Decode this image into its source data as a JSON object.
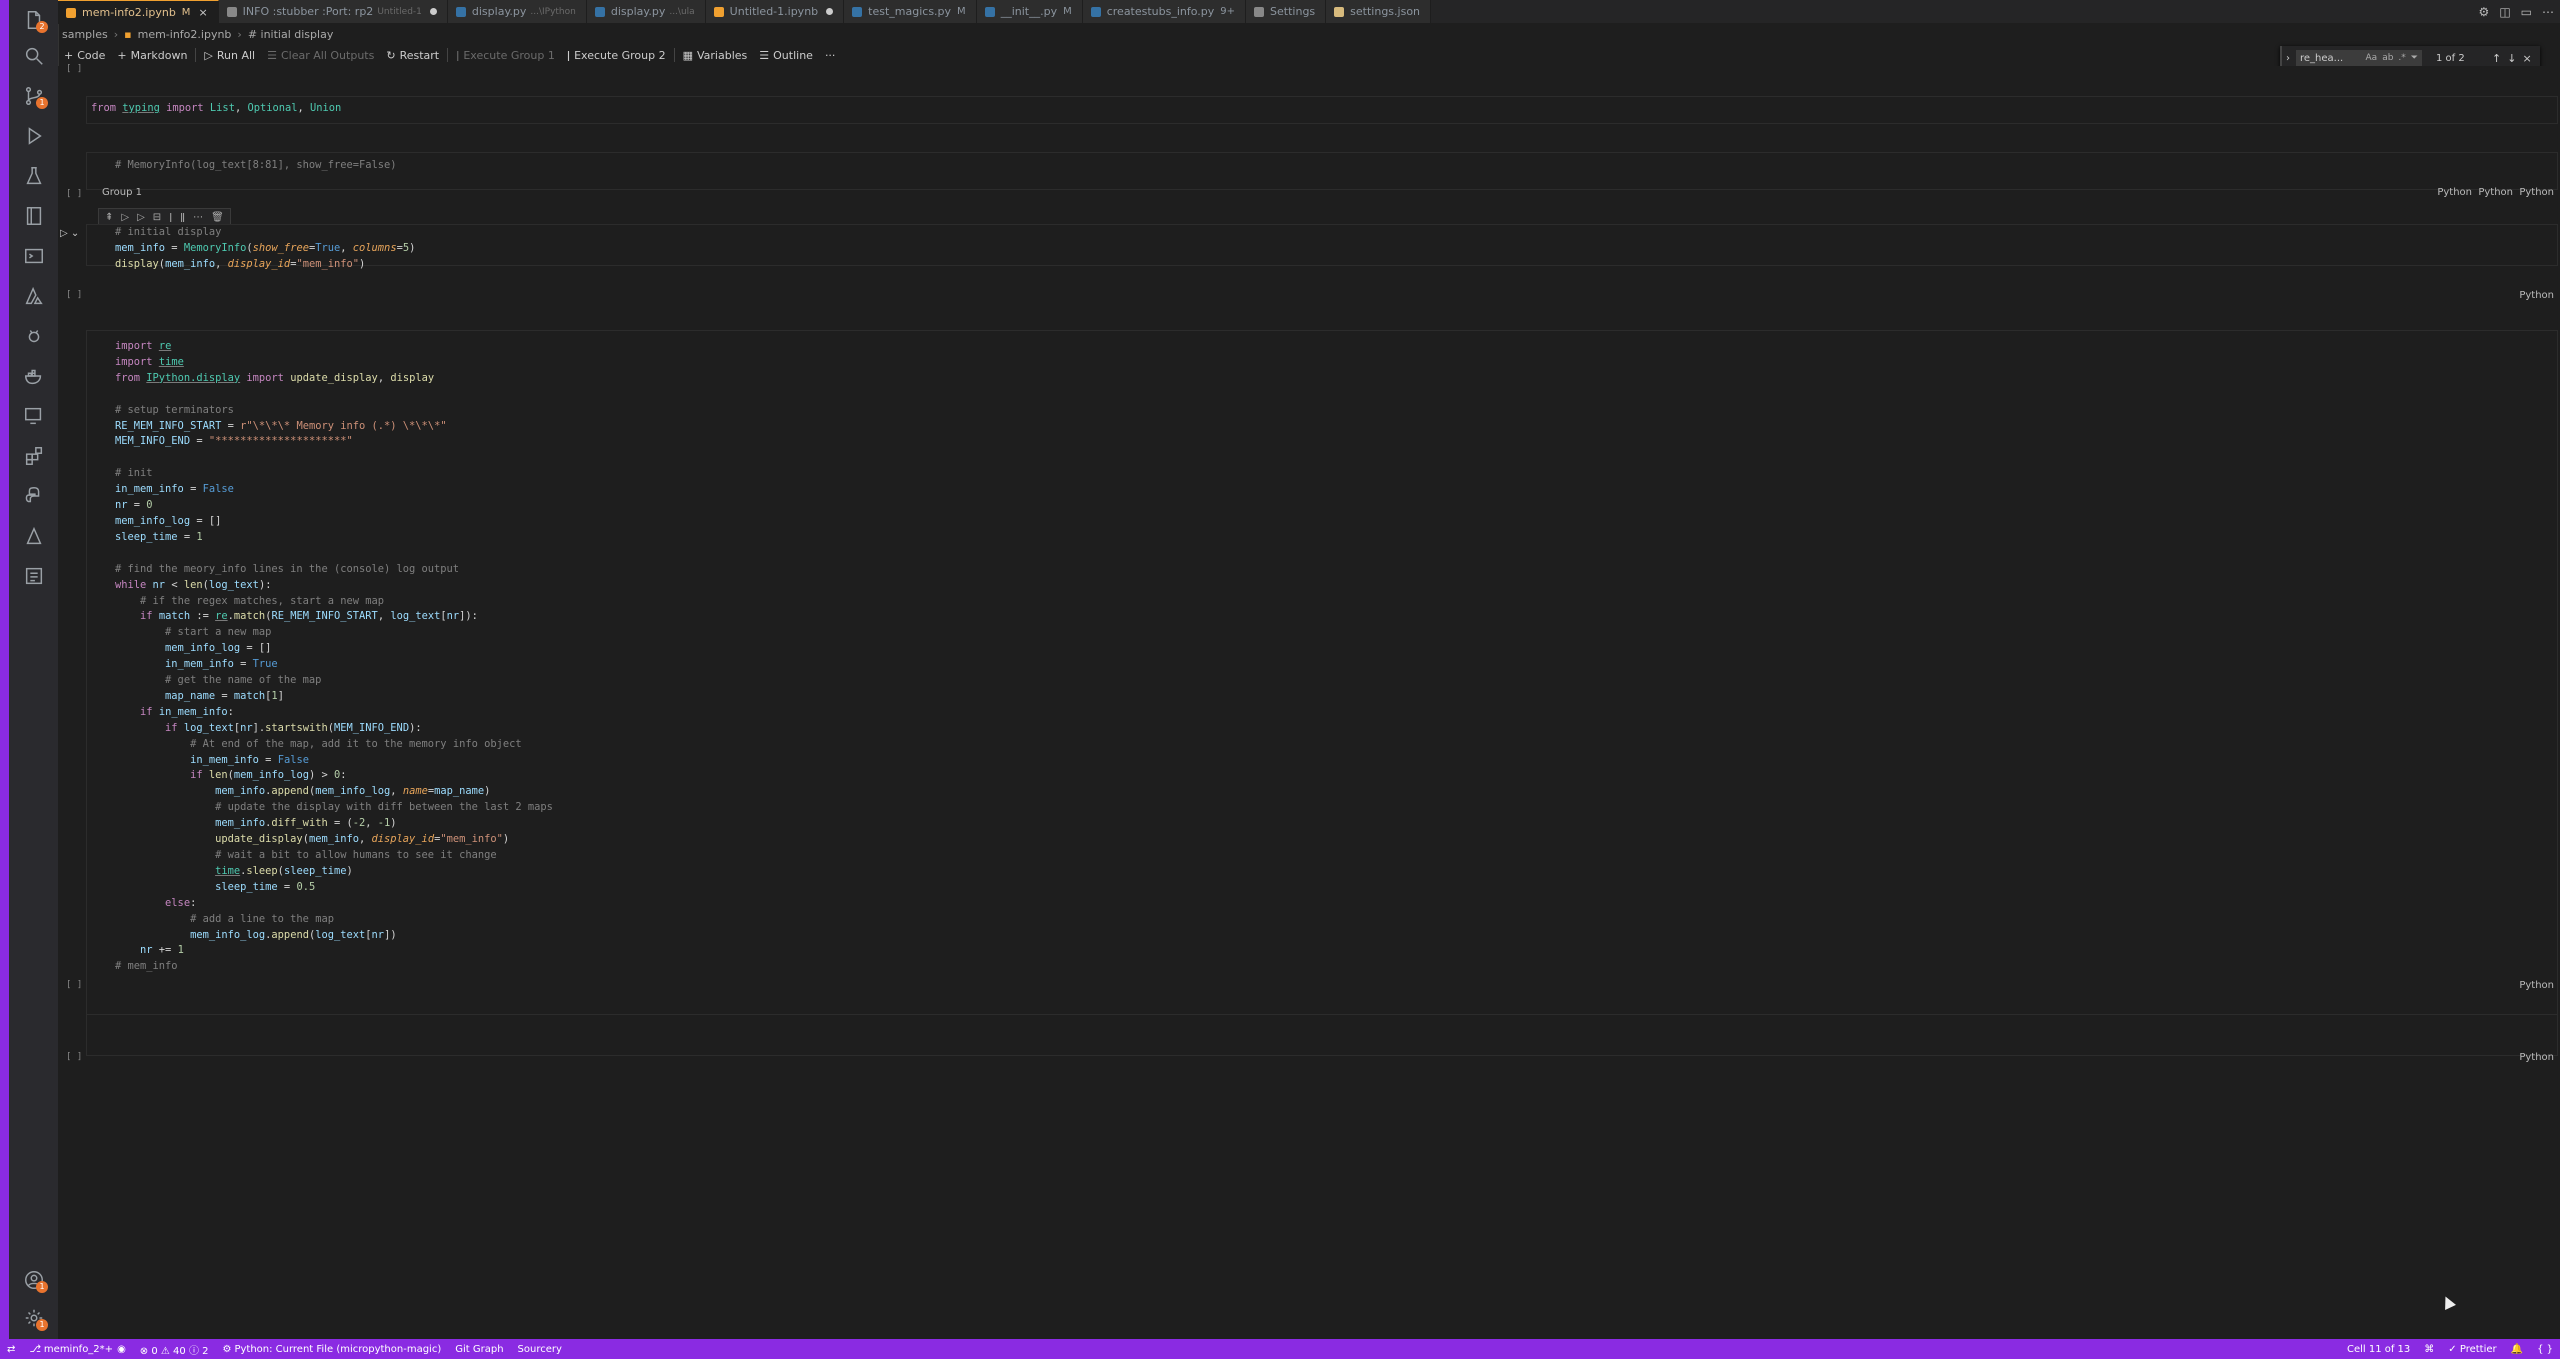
{
  "tabs": [
    {
      "label": "mem-info2.ipynb",
      "mark": "M",
      "active": true,
      "icon_color": "#f0a030",
      "close": "×"
    },
    {
      "label": "INFO :stubber :Port: rp2",
      "sub": "Untitled-1",
      "modified": true,
      "icon_color": "#888888"
    },
    {
      "label": "display.py",
      "sub": "...\\IPython",
      "icon_color": "#3572a5"
    },
    {
      "label": "display.py",
      "sub": "...\\ula",
      "icon_color": "#3572a5"
    },
    {
      "label": "Untitled-1.ipynb",
      "modified": true,
      "icon_color": "#f0a030"
    },
    {
      "label": "test_magics.py",
      "mark": "M",
      "icon_color": "#3572a5"
    },
    {
      "label": "__init__.py",
      "mark": "M",
      "icon_color": "#3572a5"
    },
    {
      "label": "createstubs_info.py",
      "mark": "9+",
      "icon_color": "#3572a5"
    },
    {
      "label": "Settings",
      "icon_color": "#888888"
    },
    {
      "label": "settings.json",
      "icon_color": "#d7ba7d"
    }
  ],
  "breadcrumbs": [
    "samples",
    "mem-info2.ipynb",
    "# initial display"
  ],
  "toolbar": {
    "code": "Code",
    "markdown": "Markdown",
    "run_all": "Run All",
    "clear_all": "Clear All Outputs",
    "restart": "Restart",
    "exec_group1": "Execute Group 1",
    "exec_group2": "Execute Group 2",
    "variables": "Variables",
    "outline": "Outline",
    "more": "···"
  },
  "find": {
    "value": "re_hea...",
    "match_case": "Aa",
    "whole_word": "ab",
    "regex": ".*",
    "count": "1 of 2"
  },
  "cells": {
    "exec_placeholder": "[ ]",
    "lang": "Python",
    "group_label": "Group 1",
    "extra_lang_1": "Python",
    "extra_lang_2": "Python"
  },
  "status": {
    "branch": "meminfo_2*+",
    "problems": "⊗ 0 ⚠ 40 ⓘ 2",
    "python": "Python: Current File (micropython-magic)",
    "git_graph": "Git Graph",
    "sourcery": "Sourcery",
    "cell_pos": "Cell 11 of 13",
    "prettier": "✓ Prettier"
  },
  "colors": {
    "accent": "#8a2be2",
    "tab_active": "#e2c08d"
  }
}
